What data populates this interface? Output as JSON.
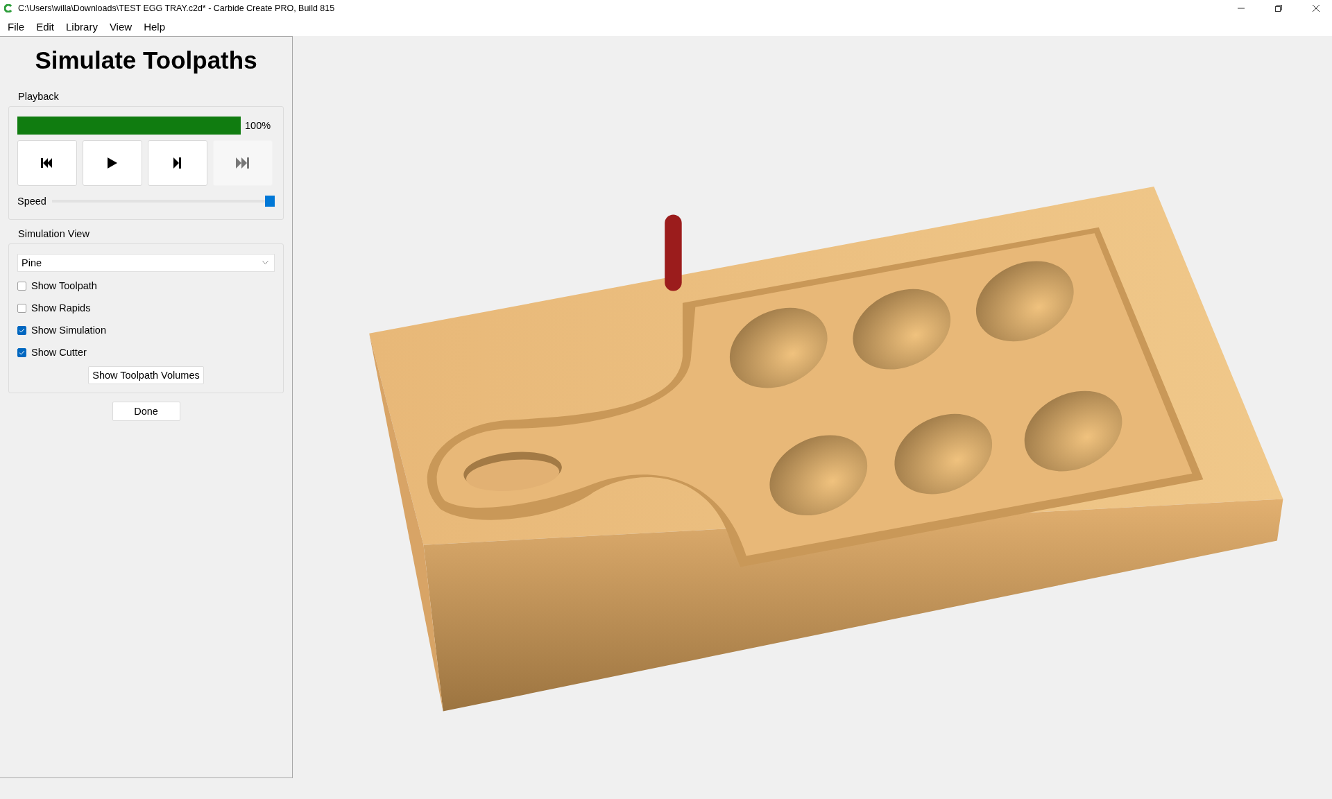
{
  "window": {
    "title": "C:\\Users\\willa\\Downloads\\TEST EGG TRAY.c2d* - Carbide Create PRO, Build 815"
  },
  "menu": [
    "File",
    "Edit",
    "Library",
    "View",
    "Help"
  ],
  "panel": {
    "title": "Simulate Toolpaths",
    "playback": {
      "label": "Playback",
      "progress": {
        "level": 1,
        "reading": "100%"
      },
      "buttons": [
        {
          "kind": "rewind",
          "disabled": false
        },
        {
          "kind": "play",
          "disabled": false
        },
        {
          "kind": "step",
          "disabled": false
        },
        {
          "kind": "end",
          "disabled": true
        }
      ],
      "speed": {
        "label": "Speed",
        "level": 1
      }
    },
    "simulation_view": {
      "label": "Simulation View",
      "material": "Pine",
      "options": [
        {
          "label": "Show Toolpath",
          "checked": false
        },
        {
          "label": "Show Rapids",
          "checked": false
        },
        {
          "label": "Show Simulation",
          "checked": true
        },
        {
          "label": "Show Cutter",
          "checked": true
        }
      ],
      "button": "Show Toolpath Volumes"
    },
    "done": "Done"
  }
}
